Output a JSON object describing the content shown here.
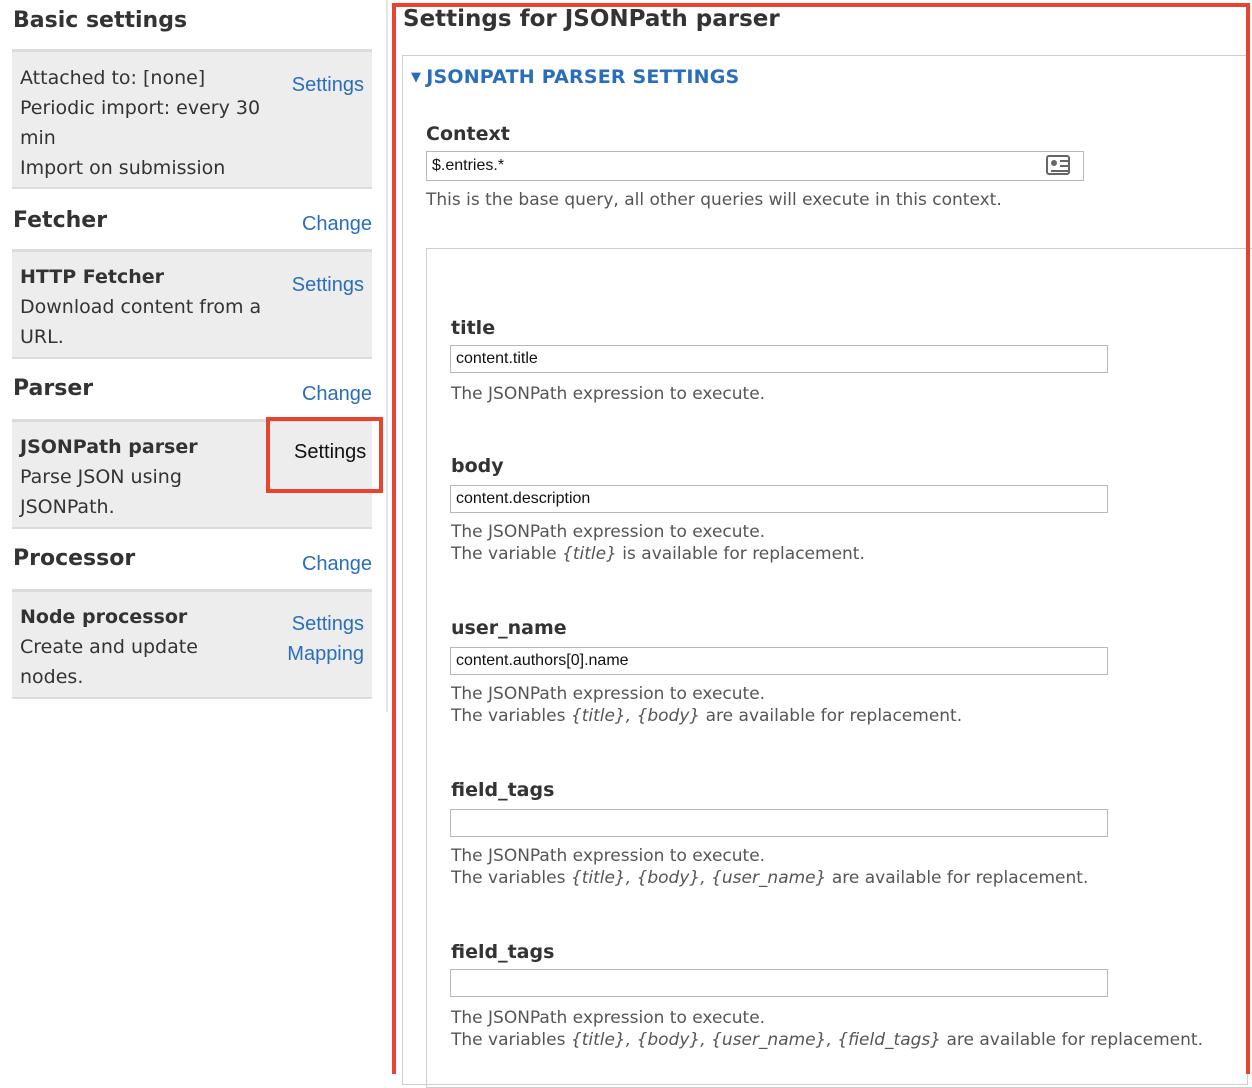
{
  "sidebar": {
    "basic": {
      "title": "Basic settings",
      "lines": [
        "Attached to: [none]",
        "Periodic import: every 30",
        "min",
        "Import on submission"
      ],
      "action": "Settings"
    },
    "fetcher": {
      "title": "Fetcher",
      "change": "Change",
      "name": "HTTP Fetcher",
      "desc_lines": [
        "Download content from a",
        "URL."
      ],
      "action": "Settings"
    },
    "parser": {
      "title": "Parser",
      "change": "Change",
      "name": "JSONPath parser",
      "desc_lines": [
        "Parse JSON using",
        "JSONPath."
      ],
      "action": "Settings"
    },
    "processor": {
      "title": "Processor",
      "change": "Change",
      "name": "Node processor",
      "desc_lines": [
        "Create and update",
        "nodes."
      ],
      "actions": [
        "Settings",
        "Mapping"
      ]
    }
  },
  "main": {
    "title": "Settings for JSONPath parser",
    "fieldset_legend": "JSONPATH PARSER SETTINGS",
    "context": {
      "label": "Context",
      "value": "$.entries.*",
      "description": "This is the base query, all other queries will execute in this context."
    },
    "fields": [
      {
        "label": "title",
        "value": "content.title",
        "desc1": "The JSONPath expression to execute.",
        "desc2_pre": "",
        "desc2_vars": "",
        "desc2_post": ""
      },
      {
        "label": "body",
        "value": "content.description",
        "desc1": "The JSONPath expression to execute.",
        "desc2_pre": "The variable ",
        "desc2_vars": "{title}",
        "desc2_post": " is available for replacement."
      },
      {
        "label": "user_name",
        "value": "content.authors[0].name",
        "desc1": "The JSONPath expression to execute.",
        "desc2_pre": "The variables ",
        "desc2_vars": "{title}, {body}",
        "desc2_post": " are available for replacement."
      },
      {
        "label": "field_tags",
        "value": "",
        "desc1": "The JSONPath expression to execute.",
        "desc2_pre": "The variables ",
        "desc2_vars": "{title}, {body}, {user_name}",
        "desc2_post": " are available for replacement."
      },
      {
        "label": "field_tags",
        "value": "",
        "desc1": "The JSONPath expression to execute.",
        "desc2_pre": "The variables ",
        "desc2_vars": "{title}, {body}, {user_name}, {field_tags}",
        "desc2_post": " are available for replacement."
      }
    ]
  },
  "colors": {
    "link": "#2a6ebb",
    "highlight": "#e8432e",
    "box_bg": "#ededed"
  }
}
